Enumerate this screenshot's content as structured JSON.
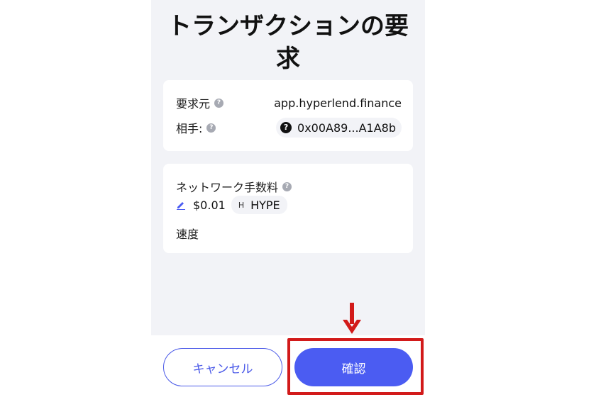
{
  "title": "トランザクションの要求",
  "request": {
    "origin_label": "要求元",
    "origin_value": "app.hyperlend.finance",
    "counterparty_label": "相手:",
    "counterparty_address": "0x00A89...A1A8b",
    "counterparty_icon": "?"
  },
  "fees": {
    "network_fee_label": "ネットワーク手数料",
    "fee_value": "$0.01",
    "token_letter": "H",
    "token_symbol": "HYPE",
    "speed_label": "速度"
  },
  "help_glyph": "?",
  "buttons": {
    "cancel": "キャンセル",
    "confirm": "確認"
  },
  "colors": {
    "accent": "#4b5cf2",
    "highlight": "#d21a1a",
    "panel_bg": "#f2f3f7"
  },
  "icons": {
    "help": "question-circle-icon",
    "address": "question-badge-icon",
    "edit": "pencil-icon",
    "annotation": "down-arrow-icon"
  }
}
